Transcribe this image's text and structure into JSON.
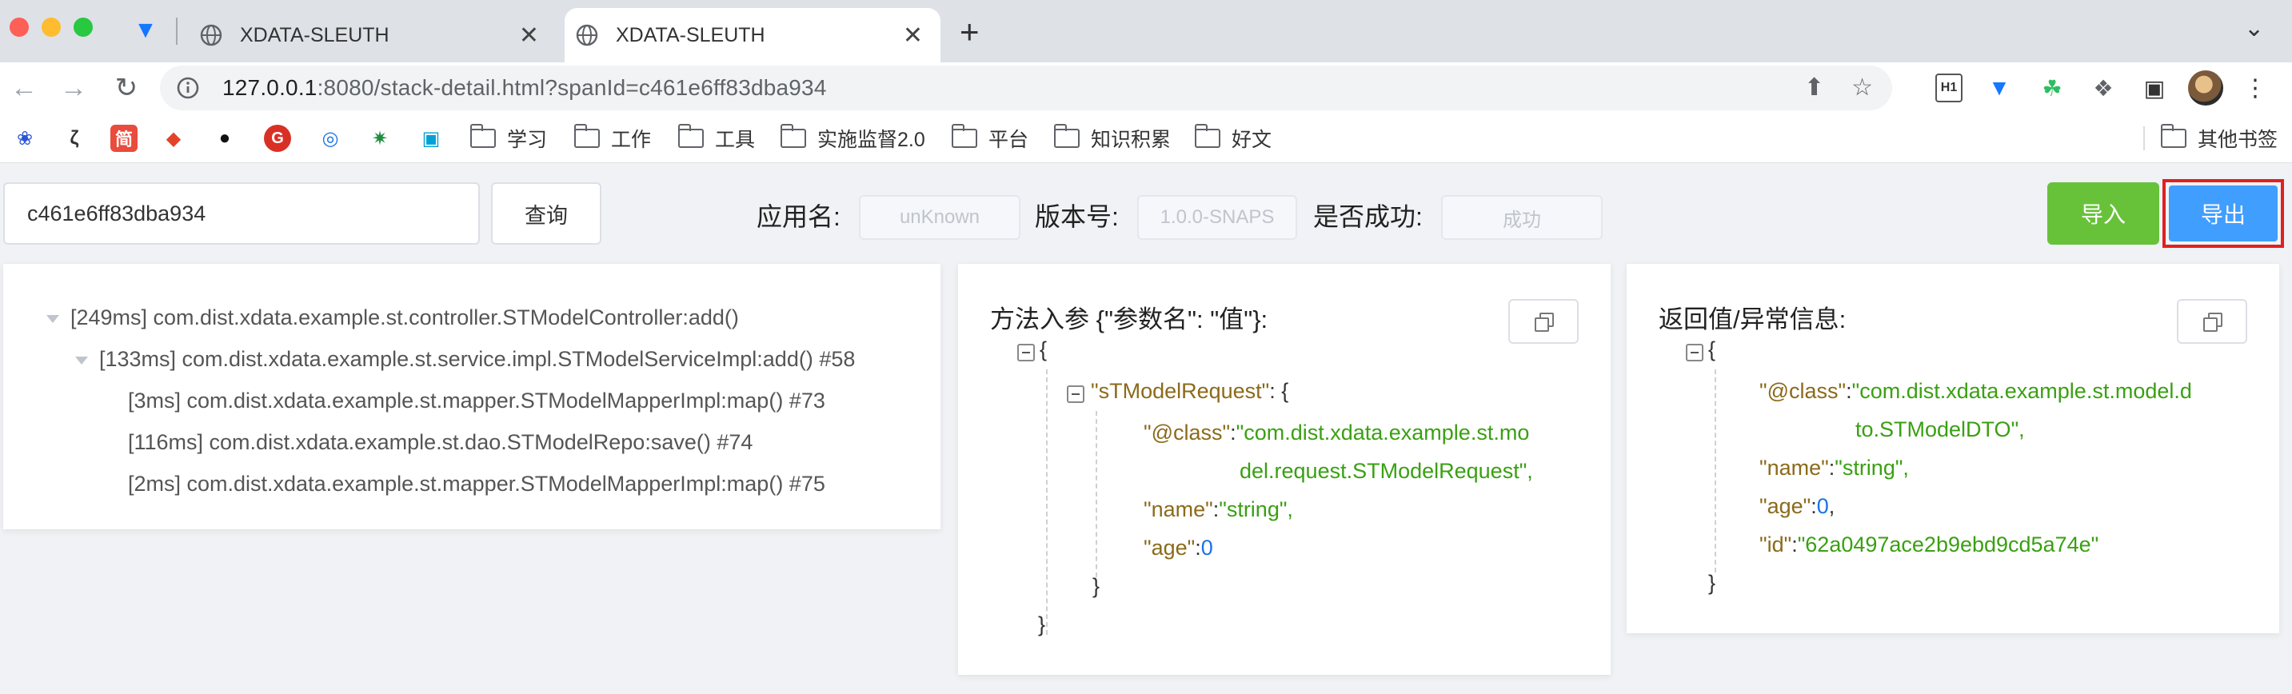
{
  "browser": {
    "tabs": [
      {
        "title": "XDATA-SLEUTH",
        "active": false
      },
      {
        "title": "XDATA-SLEUTH",
        "active": true
      }
    ],
    "new_tab_symbol": "+",
    "url_host": "127.0.0.1",
    "url_rest": ":8080/stack-detail.html?spanId=c461e6ff83dba934",
    "extensions": [
      "h1-icon",
      "kite-icon",
      "evernote-icon",
      "puzzle-icon",
      "side-panel-icon",
      "avatar",
      "menu-icon"
    ],
    "ext_h1_label": "H1"
  },
  "bookmarks": {
    "icons": [
      "baidu-icon",
      "edge-letter-icon",
      "jian-icon",
      "gitlab-icon",
      "github-icon",
      "g-icon",
      "chrome-like-icon",
      "virus-icon",
      "bilibili-icon"
    ],
    "jian_label": "简",
    "folders": [
      "学习",
      "工作",
      "工具",
      "实施监督2.0",
      "平台",
      "知识积累",
      "好文"
    ],
    "other": "其他书签"
  },
  "search": {
    "value": "c461e6ff83dba934",
    "button": "查询"
  },
  "filters": {
    "app_label": "应用名:",
    "app_value": "unKnown",
    "version_label": "版本号:",
    "version_value": "1.0.0-SNAPS",
    "success_label": "是否成功:",
    "success_value": "成功"
  },
  "actions": {
    "import": "导入",
    "export": "导出"
  },
  "colors": {
    "import_bg": "#67c23a",
    "export_bg": "#409eff",
    "highlight_border": "#e02020",
    "json_string": "#3aa012",
    "json_number": "#1a73e8",
    "json_key": "#8b6a1a"
  },
  "trace": {
    "rows": [
      {
        "text": "[249ms] com.dist.xdata.example.st.controller.STModelController:add()",
        "expandable": true
      },
      {
        "text": "[133ms] com.dist.xdata.example.st.service.impl.STModelServiceImpl:add() #58",
        "expandable": true
      },
      {
        "text": "[3ms] com.dist.xdata.example.st.mapper.STModelMapperImpl:map() #73",
        "expandable": false
      },
      {
        "text": "[116ms] com.dist.xdata.example.st.dao.STModelRepo:save() #74",
        "expandable": false
      },
      {
        "text": "[2ms] com.dist.xdata.example.st.mapper.STModelMapperImpl:map() #75",
        "expandable": false
      }
    ]
  },
  "params": {
    "title": "方法入参 {\"参数名\": \"值\"}:",
    "open_brace": "{",
    "close_brace": "}",
    "obj_key": "\"sTModelRequest\"",
    "obj_sep": ": {",
    "class_key": "\"@class\"",
    "class_val_1": "\"com.dist.xdata.example.st.mo",
    "class_val_2": "del.request.STModelRequest\",",
    "name_key": "\"name\"",
    "name_val": "\"string\",",
    "age_key": "\"age\"",
    "age_val": "0",
    "colon": ":"
  },
  "returns": {
    "title": "返回值/异常信息:",
    "open_brace": "{",
    "close_brace": "}",
    "class_key": "\"@class\"",
    "class_val_1": "\"com.dist.xdata.example.st.model.d",
    "class_val_2": "to.STModelDTO\",",
    "name_key": "\"name\"",
    "name_val": "\"string\",",
    "age_key": "\"age\"",
    "age_val": "0",
    "age_comma": ",",
    "id_key": "\"id\"",
    "id_val": "\"62a0497ace2b9ebd9cd5a74e\"",
    "colon": ":"
  }
}
